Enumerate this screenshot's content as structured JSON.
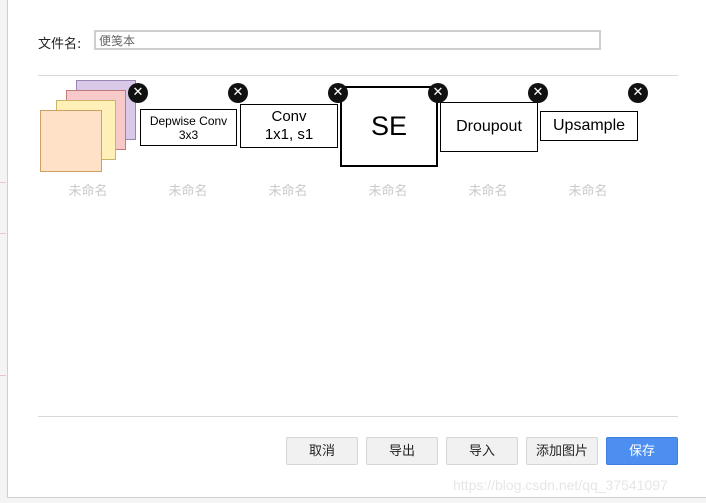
{
  "file_name": {
    "label": "文件名:",
    "value": "便笺本"
  },
  "shapes": [
    {
      "label": "未命名",
      "lines": []
    },
    {
      "label": "未命名",
      "lines": [
        "Depwise Conv",
        "3x3"
      ]
    },
    {
      "label": "未命名",
      "lines": [
        "Conv",
        "1x1, s1"
      ]
    },
    {
      "label": "未命名",
      "lines": [
        "SE"
      ]
    },
    {
      "label": "未命名",
      "lines": [
        "Droupout"
      ]
    },
    {
      "label": "未命名",
      "lines": [
        "Upsample"
      ]
    }
  ],
  "close_glyph": "✕",
  "buttons": {
    "cancel": "取消",
    "export": "导出",
    "import": "导入",
    "add_image": "添加图片",
    "save": "保存"
  },
  "colors": {
    "primary": "#4c8ff0",
    "sheet_back": "#d9c8e8",
    "sheet_2": "#f7c9c9",
    "sheet_3": "#fff0b8",
    "sheet_front": "#ffe1c8"
  },
  "watermark": "https://blog.csdn.net/qq_37541097"
}
